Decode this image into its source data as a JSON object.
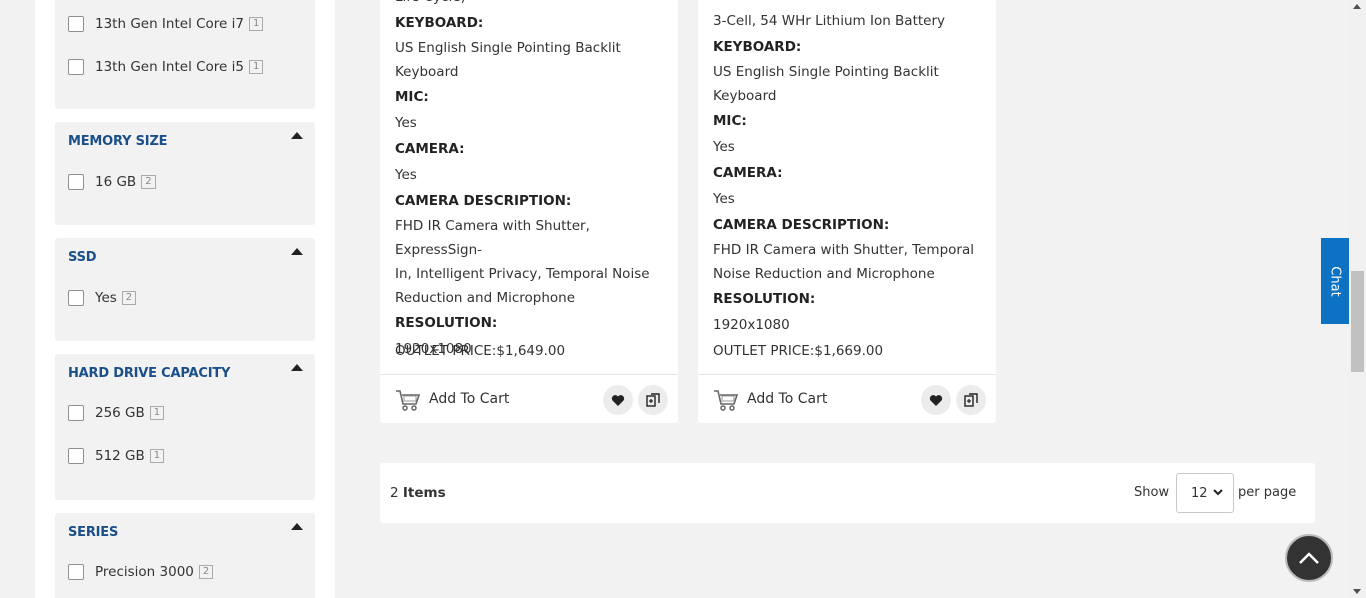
{
  "filters": {
    "processor": {
      "options": [
        {
          "label": "13th Gen Intel Core i7",
          "count": "1"
        },
        {
          "label": "13th Gen Intel Core i5",
          "count": "1"
        }
      ]
    },
    "memory": {
      "title": "MEMORY SIZE",
      "options": [
        {
          "label": "16 GB",
          "count": "2"
        }
      ]
    },
    "ssd": {
      "title": "SSD",
      "options": [
        {
          "label": "Yes",
          "count": "2"
        }
      ]
    },
    "hdd": {
      "title": "HARD DRIVE CAPACITY",
      "options": [
        {
          "label": "256 GB",
          "count": "1"
        },
        {
          "label": "512 GB",
          "count": "1"
        }
      ]
    },
    "series": {
      "title": "SERIES",
      "options": [
        {
          "label": "Precision 3000",
          "count": "2"
        }
      ]
    }
  },
  "products": [
    {
      "partial_top": "Life Cycle)",
      "keyboard_key": "KEYBOARD:",
      "keyboard_val_1": "US English Single Pointing Backlit",
      "keyboard_val_2": "Keyboard",
      "mic_key": "MIC:",
      "mic_val": "Yes",
      "camera_key": "CAMERA:",
      "camera_val": "Yes",
      "camdesc_key": "CAMERA DESCRIPTION:",
      "camdesc_val_1": "FHD IR Camera with Shutter, ExpressSign-",
      "camdesc_val_2": "In, Intelligent Privacy, Temporal Noise",
      "camdesc_val_3": "Reduction and Microphone",
      "resolution_key": "RESOLUTION:",
      "resolution_val": "1920x1080",
      "price": "OUTLET PRICE:$1,649.00",
      "cart_label": "Add To Cart"
    },
    {
      "battery": "3-Cell, 54 WHr Lithium Ion Battery",
      "keyboard_key": "KEYBOARD:",
      "keyboard_val_1": "US English Single Pointing Backlit",
      "keyboard_val_2": "Keyboard",
      "mic_key": "MIC:",
      "mic_val": "Yes",
      "camera_key": "CAMERA:",
      "camera_val": "Yes",
      "camdesc_key": "CAMERA DESCRIPTION:",
      "camdesc_val_1": "FHD IR Camera with Shutter, Temporal",
      "camdesc_val_2": "Noise Reduction and Microphone",
      "resolution_key": "RESOLUTION:",
      "resolution_val": "1920x1080",
      "price": "OUTLET PRICE:$1,669.00",
      "cart_label": "Add To Cart"
    }
  ],
  "toolbar": {
    "count_number": "2",
    "count_label": "Items",
    "show_label": "Show",
    "limiter_value": "12",
    "per_page_label": "per page"
  },
  "chat": {
    "label": "Chat"
  },
  "colors": {
    "accent": "#1a4f8a",
    "chat": "#0b72c4"
  }
}
